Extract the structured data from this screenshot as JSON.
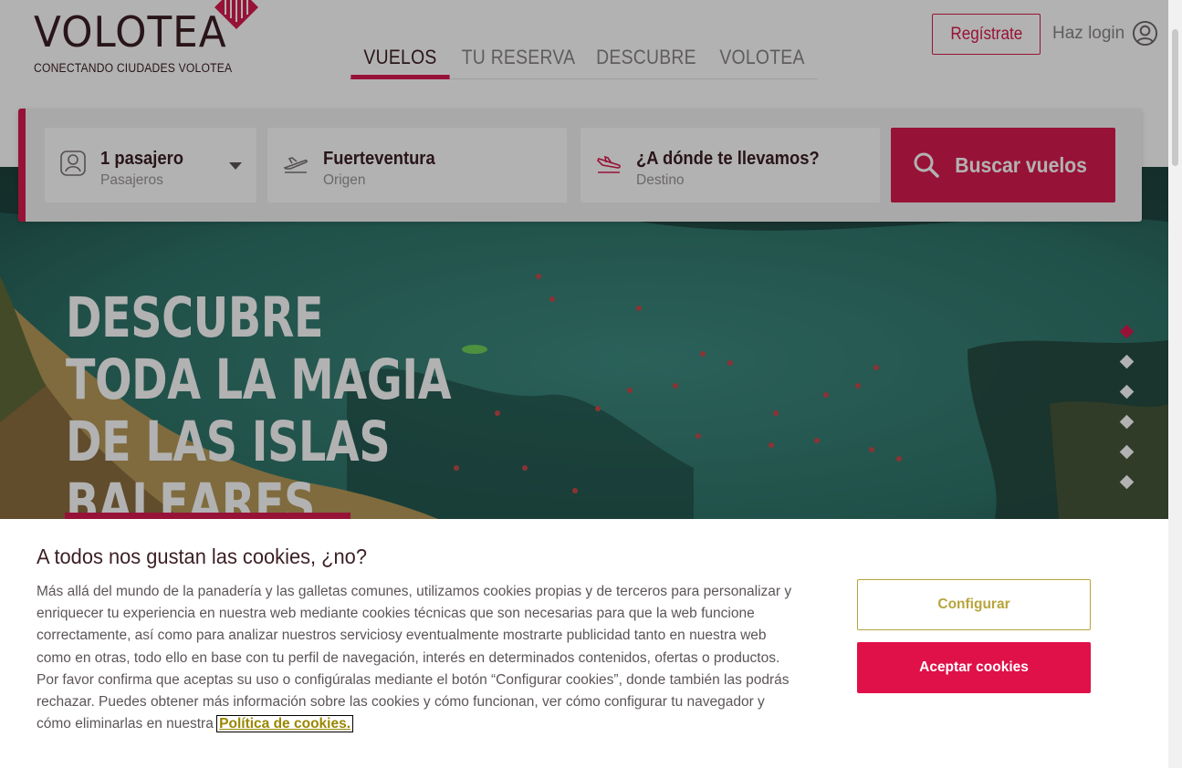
{
  "brand": {
    "name": "VOLOTEA",
    "tagline": "CONECTANDO CIUDADES VOLOTEA",
    "accent": "#d81b4f",
    "dark": "#3b1f24"
  },
  "nav": {
    "items": [
      {
        "label": "VUELOS",
        "active": true
      },
      {
        "label": "TU RESERVA",
        "active": false
      },
      {
        "label": "DESCUBRE",
        "active": false
      },
      {
        "label": "VOLOTEA",
        "active": false
      }
    ]
  },
  "account": {
    "register_label": "Regístrate",
    "login_label": "Haz login",
    "login_icon": "user-circle-icon"
  },
  "search": {
    "passengers": {
      "value": "1 pasajero",
      "label": "Pasajeros",
      "icon": "passenger-icon"
    },
    "origin": {
      "value": "Fuerteventura",
      "label": "Origen",
      "icon": "plane-takeoff-icon"
    },
    "destination": {
      "value": "¿A dónde te llevamos?",
      "label": "Destino",
      "icon": "plane-landing-icon"
    },
    "button_label": "Buscar vuelos"
  },
  "hero": {
    "title": "DESCUBRE TODA LA MAGIA DE LAS ISLAS BALEARES",
    "slides_total": 6,
    "active_slide": 1
  },
  "cookies": {
    "title": "A todos nos gustan las cookies, ¿no?",
    "text": "Más allá del mundo de la panadería y las galletas comunes, utilizamos cookies propias y de terceros para personalizar y enriquecer tu experiencia en nuestra web mediante cookies técnicas que son necesarias para que la web funcione correctamente, así como para analizar nuestros serviciosy eventualmente mostrarte publicidad tanto en nuestra web como en otras, todo ello en base con tu perfil de navegación, interés en determinados contenidos, ofertas o productos. Por favor confirma que aceptas su uso o configúralas mediante el botón “Configurar cookies”, donde también las podrás rechazar. Puedes obtener más información sobre las cookies y cómo funcionan, ver cómo configurar tu navegador y cómo eliminarlas en nuestra ",
    "link_label": "Política de cookies.",
    "configure_label": "Configurar",
    "accept_label": "Aceptar cookies"
  }
}
